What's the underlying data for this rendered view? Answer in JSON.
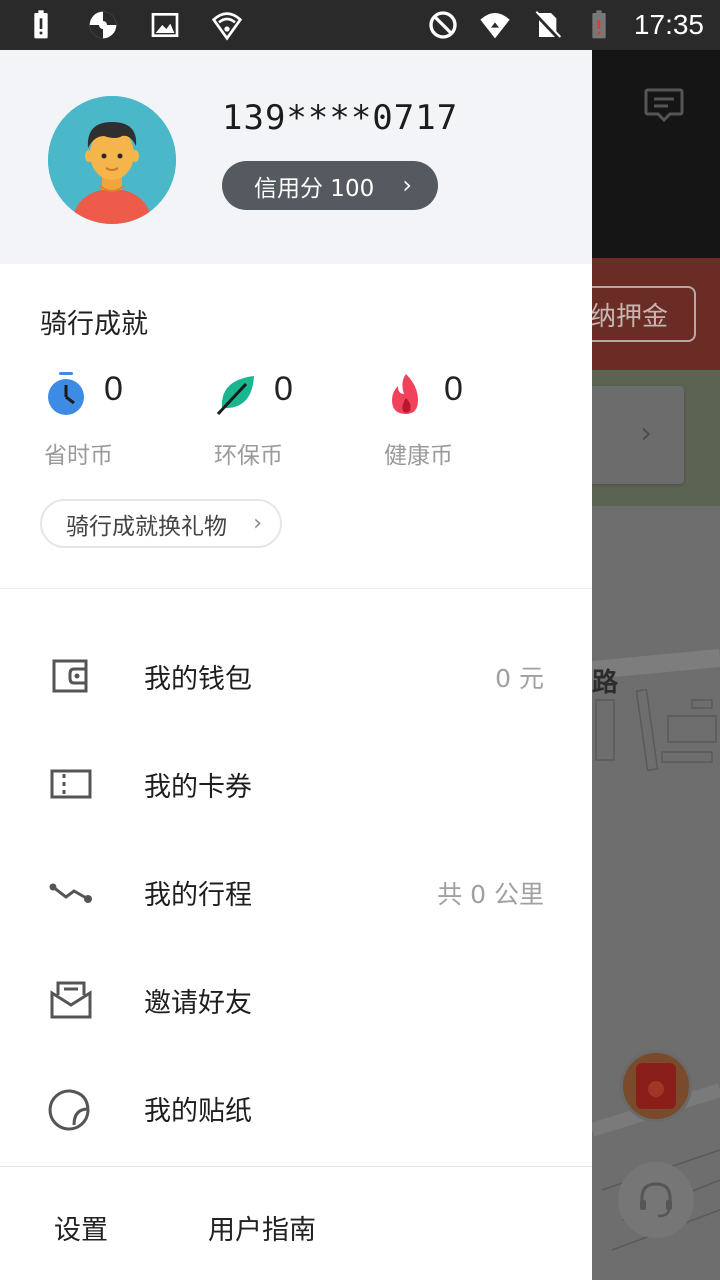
{
  "status_bar": {
    "time": "17:35",
    "left_icons": [
      "battery-alert-icon",
      "sync-icon",
      "image-icon",
      "shield-wifi-icon"
    ],
    "right_icons": [
      "do-not-disturb-icon",
      "wifi-icon",
      "no-sim-icon",
      "battery-low-icon"
    ]
  },
  "profile": {
    "phone": "139****0717",
    "credit_label": "信用分 100"
  },
  "achievements": {
    "title": "骑行成就",
    "coins": [
      {
        "label": "省时币",
        "value": "0",
        "icon": "stopwatch-icon",
        "color": "#3e8be6"
      },
      {
        "label": "环保币",
        "value": "0",
        "icon": "leaf-icon",
        "color": "#19b690"
      },
      {
        "label": "健康币",
        "value": "0",
        "icon": "flame-icon",
        "color": "#f0425a"
      }
    ],
    "exchange_label": "骑行成就换礼物"
  },
  "menu": [
    {
      "label": "我的钱包",
      "value": "0 元",
      "icon": "wallet-icon"
    },
    {
      "label": "我的卡券",
      "value": "",
      "icon": "coupon-icon"
    },
    {
      "label": "我的行程",
      "value": "共 0 公里",
      "icon": "trip-icon"
    },
    {
      "label": "邀请好友",
      "value": "",
      "icon": "invite-envelope-icon"
    },
    {
      "label": "我的贴纸",
      "value": "",
      "icon": "sticker-icon"
    }
  ],
  "footer": {
    "settings": "设置",
    "guide": "用户指南"
  },
  "background_app": {
    "deposit_text": "纳押金",
    "road_text": "路"
  }
}
